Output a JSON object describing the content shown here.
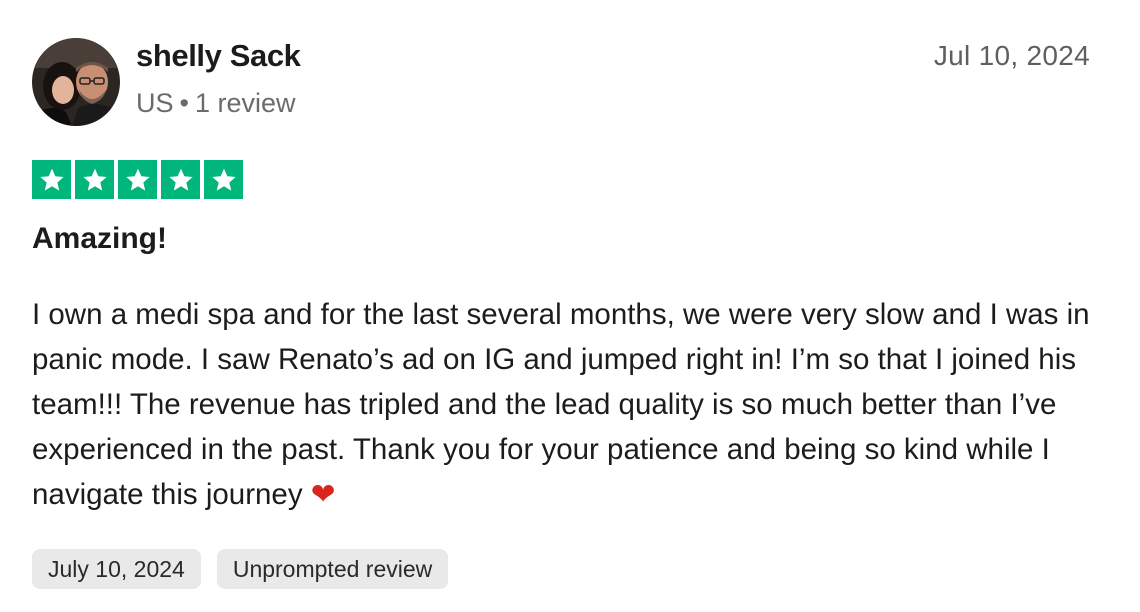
{
  "reviewer": {
    "name": "shelly Sack",
    "country": "US",
    "separator": "•",
    "review_count": "1 review"
  },
  "review": {
    "date": "Jul 10, 2024",
    "rating": 5,
    "rating_max": 5,
    "star_color": "#00b67a",
    "title": "Amazing!",
    "body": "I own a medi spa and for the last several months, we were very slow and I was in panic mode. I saw Renato’s ad on IG and jumped right in! I’m so that I joined his team!!! The revenue has tripled and the lead quality is so much better than I’ve experienced in the past. Thank you for your patience and being so kind while I navigate this journey",
    "body_emoji": "❤"
  },
  "chips": {
    "experience_date": "July 10, 2024",
    "review_type": "Unprompted review"
  },
  "icons": {
    "avatar": "reviewer-photo",
    "star": "star-icon",
    "heart": "heart-icon"
  }
}
